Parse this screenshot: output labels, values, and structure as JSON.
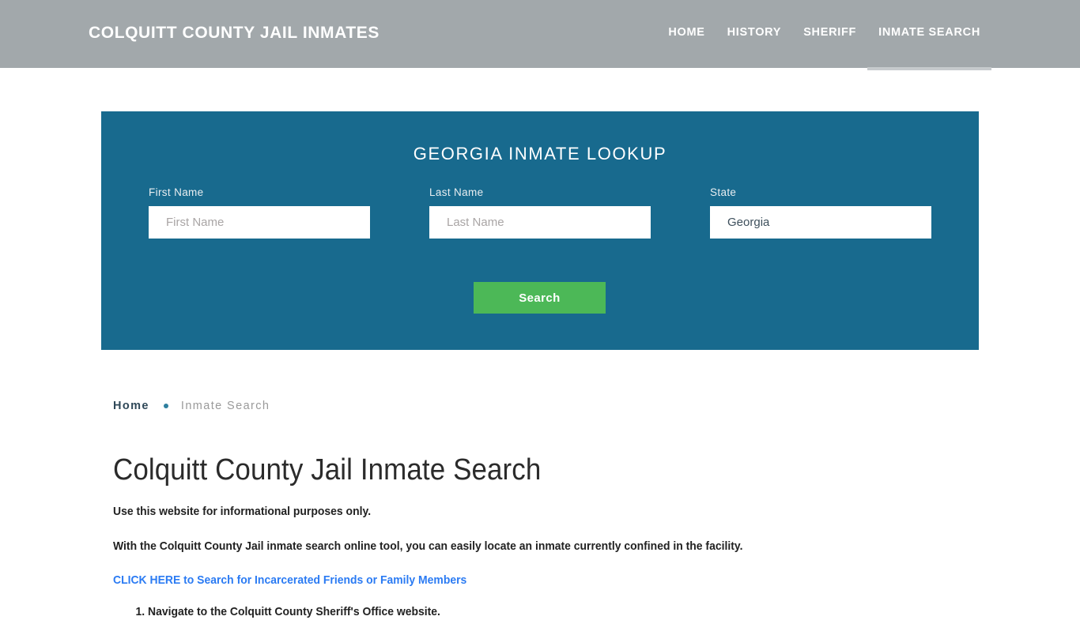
{
  "header": {
    "site_title": "COLQUITT COUNTY JAIL INMATES",
    "background_color": "#a2a8ab",
    "nav": [
      {
        "label": "HOME",
        "active": false
      },
      {
        "label": "HISTORY",
        "active": false
      },
      {
        "label": "SHERIFF",
        "active": false
      },
      {
        "label": "INMATE SEARCH",
        "active": true
      }
    ]
  },
  "search_panel": {
    "title": "GEORGIA INMATE LOOKUP",
    "background_color": "#186a8e",
    "fields": [
      {
        "label": "First Name",
        "placeholder": "First Name",
        "value": ""
      },
      {
        "label": "Last Name",
        "placeholder": "Last Name",
        "value": ""
      },
      {
        "label": "State",
        "placeholder": "State",
        "value": "Georgia"
      }
    ],
    "submit_label": "Search",
    "submit_color": "#4cb857"
  },
  "breadcrumb": {
    "home_label": "Home",
    "separator": "•",
    "current_label": "Inmate Search"
  },
  "main": {
    "heading": "Colquitt County Jail Inmate Search",
    "paragraph_1": "Use this website for informational purposes only.",
    "paragraph_2": "With the Colquitt County Jail inmate search online tool, you can easily locate an inmate currently confined in the facility.",
    "link_text": "CLICK HERE to Search for Incarcerated Friends or Family Members",
    "link_color": "#2b7bf3",
    "steps": [
      "Navigate to the Colquitt County Sheriff's Office website."
    ]
  }
}
